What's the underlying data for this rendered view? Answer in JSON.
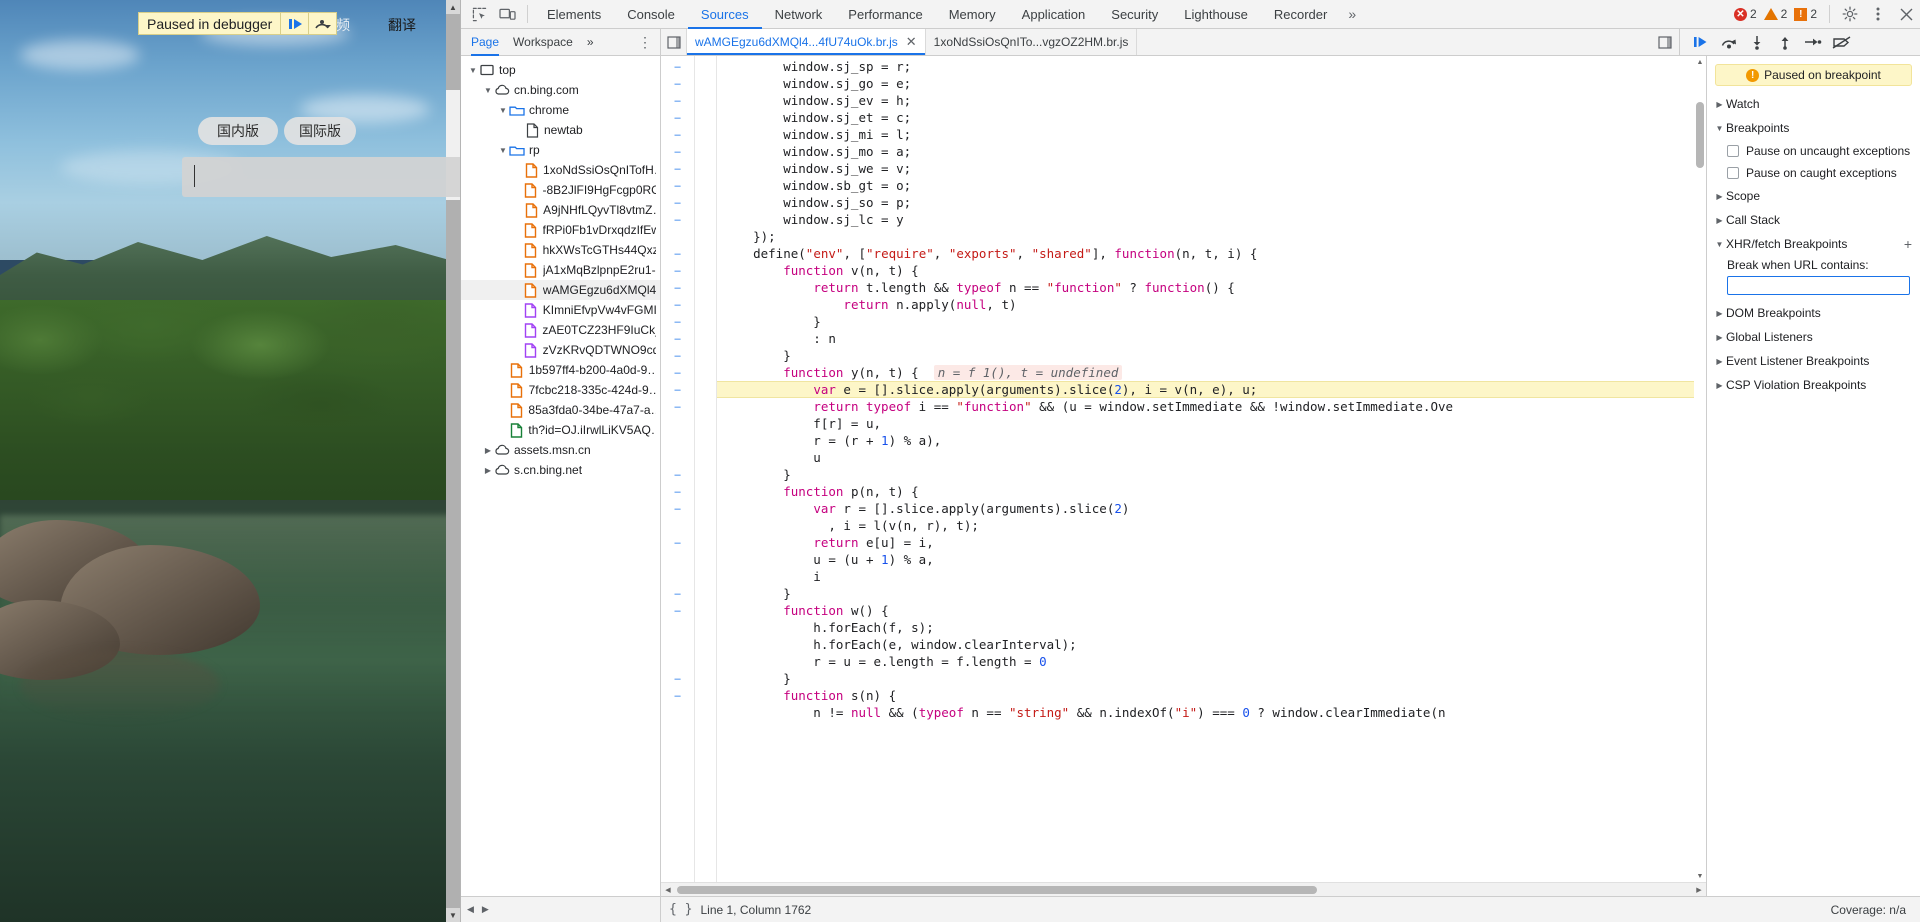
{
  "browser": {
    "paused_banner": {
      "text": "Paused in debugger",
      "resume_icon": "resume-icon",
      "step-over_icon": "step-over-icon"
    },
    "labels": {
      "video": "视频",
      "translate": "翻译"
    },
    "buttons": {
      "domestic": "国内版",
      "international": "国际版"
    },
    "search_placeholder": ""
  },
  "devtools": {
    "tabs": [
      {
        "label": "Elements",
        "active": false
      },
      {
        "label": "Console",
        "active": false
      },
      {
        "label": "Sources",
        "active": true
      },
      {
        "label": "Network",
        "active": false
      },
      {
        "label": "Performance",
        "active": false
      },
      {
        "label": "Memory",
        "active": false
      },
      {
        "label": "Application",
        "active": false
      },
      {
        "label": "Security",
        "active": false
      },
      {
        "label": "Lighthouse",
        "active": false
      },
      {
        "label": "Recorder",
        "active": false
      }
    ],
    "overflow_label": "»",
    "counters": {
      "errors": "2",
      "warnings": "2",
      "issues": "2"
    },
    "navigator_tabs": [
      {
        "label": "Page",
        "active": true
      },
      {
        "label": "Workspace",
        "active": false
      },
      {
        "label": "»",
        "active": false
      }
    ],
    "file_tabs": [
      {
        "label": "wAMGEgzu6dXMQl4...4fU74uOk.br.js",
        "active": true,
        "closeable": true
      },
      {
        "label": "1xoNdSsiOsQnITo...vgzOZ2HM.br.js",
        "active": false,
        "closeable": false
      }
    ],
    "debug_toolbar": [
      {
        "name": "resume-script-execution",
        "label": "▶"
      },
      {
        "name": "step-over-next-call",
        "label": "↷"
      },
      {
        "name": "step-into-next-call",
        "label": "↓"
      },
      {
        "name": "step-out-of-current-function",
        "label": "↑"
      },
      {
        "name": "step",
        "label": "→"
      },
      {
        "name": "deactivate-breakpoints",
        "label": "⊘"
      }
    ],
    "tree": [
      {
        "indent": 0,
        "twisty": "▼",
        "icon": "frame-icon",
        "label": "top"
      },
      {
        "indent": 1,
        "twisty": "▼",
        "icon": "cloud-icon",
        "label": "cn.bing.com"
      },
      {
        "indent": 2,
        "twisty": "▼",
        "icon": "folder-icon",
        "label": "chrome"
      },
      {
        "indent": 3,
        "twisty": "",
        "icon": "document-icon",
        "label": "newtab"
      },
      {
        "indent": 2,
        "twisty": "▼",
        "icon": "folder-icon",
        "label": "rp"
      },
      {
        "indent": 3,
        "twisty": "",
        "icon": "js-file-icon",
        "label": "1xoNdSsiOsQnITofH…"
      },
      {
        "indent": 3,
        "twisty": "",
        "icon": "js-file-icon",
        "label": "-8B2JlFI9HgFcgp0RG…"
      },
      {
        "indent": 3,
        "twisty": "",
        "icon": "js-file-icon",
        "label": "A9jNHfLQyvTl8vtmZ…"
      },
      {
        "indent": 3,
        "twisty": "",
        "icon": "js-file-icon",
        "label": "fRPi0Fb1vDrxqdzIfEw…"
      },
      {
        "indent": 3,
        "twisty": "",
        "icon": "js-file-icon",
        "label": "hkXWsTcGTHs44Qxz…"
      },
      {
        "indent": 3,
        "twisty": "",
        "icon": "js-file-icon",
        "label": "jA1xMqBzlpnpE2ru1-…"
      },
      {
        "indent": 3,
        "twisty": "",
        "icon": "js-file-icon",
        "label": "wAMGEgzu6dXMQl4…",
        "selected": true
      },
      {
        "indent": 3,
        "twisty": "",
        "icon": "css-file-icon",
        "label": "KImniEfvpVw4vFGMI…"
      },
      {
        "indent": 3,
        "twisty": "",
        "icon": "css-file-icon",
        "label": "zAE0TCZ23HF9IuCk_…"
      },
      {
        "indent": 3,
        "twisty": "",
        "icon": "css-file-icon",
        "label": "zVzKRvQDTWNO9cq…"
      },
      {
        "indent": 2,
        "twisty": "",
        "icon": "js-file-icon",
        "label": "1b597ff4-b200-4a0d-9…"
      },
      {
        "indent": 2,
        "twisty": "",
        "icon": "js-file-icon",
        "label": "7fcbc218-335c-424d-9…"
      },
      {
        "indent": 2,
        "twisty": "",
        "icon": "js-file-icon",
        "label": "85a3fda0-34be-47a7-a…"
      },
      {
        "indent": 2,
        "twisty": "",
        "icon": "image-file-icon",
        "label": "th?id=OJ.iIrwlLiKV5AQ…"
      },
      {
        "indent": 1,
        "twisty": "▶",
        "icon": "cloud-icon",
        "label": "assets.msn.cn"
      },
      {
        "indent": 1,
        "twisty": "▶",
        "icon": "cloud-icon",
        "label": "s.cn.bing.net"
      }
    ],
    "code_lines": [
      {
        "text": "        window.sj_sp = r;",
        "fold": "–"
      },
      {
        "text": "        window.sj_go = e;",
        "fold": "–"
      },
      {
        "text": "        window.sj_ev = h;",
        "fold": "–"
      },
      {
        "text": "        window.sj_et = c;",
        "fold": "–"
      },
      {
        "text": "        window.sj_mi = l;",
        "fold": "–"
      },
      {
        "text": "        window.sj_mo = a;",
        "fold": "–"
      },
      {
        "text": "        window.sj_we = v;",
        "fold": "–"
      },
      {
        "text": "        window.sb_gt = o;",
        "fold": "–"
      },
      {
        "text": "        window.sj_so = p;",
        "fold": "–"
      },
      {
        "text": "        window.sj_lc = y",
        "fold": "–"
      },
      {
        "text": "    });",
        "fold": ""
      },
      {
        "text": "    define(\"env\", [\"require\", \"exports\", \"shared\"], function(n, t, i) {",
        "fold": "–"
      },
      {
        "text": "        function v(n, t) {",
        "fold": "–"
      },
      {
        "text": "            return t.length && typeof n == \"function\" ? function() {",
        "fold": "–"
      },
      {
        "text": "                return n.apply(null, t)",
        "fold": "–"
      },
      {
        "text": "            }",
        "fold": "–"
      },
      {
        "text": "            : n",
        "fold": "–"
      },
      {
        "text": "        }",
        "fold": "–"
      },
      {
        "text": "        function y(n, t) {",
        "fold": "–",
        "annotation": "n = f 1(), t = undefined"
      },
      {
        "text": "            var e = [].slice.apply(arguments).slice(2), i = v(n, e), u;",
        "fold": "–",
        "highlight": true
      },
      {
        "text": "            return typeof i == \"function\" && (u = window.setImmediate && !window.setImmediate.Ove",
        "fold": "–"
      },
      {
        "text": "            f[r] = u,",
        "fold": ""
      },
      {
        "text": "            r = (r + 1) % a),",
        "fold": ""
      },
      {
        "text": "            u",
        "fold": ""
      },
      {
        "text": "        }",
        "fold": "–"
      },
      {
        "text": "        function p(n, t) {",
        "fold": "–"
      },
      {
        "text": "            var r = [].slice.apply(arguments).slice(2)",
        "fold": "–"
      },
      {
        "text": "              , i = l(v(n, r), t);",
        "fold": ""
      },
      {
        "text": "            return e[u] = i,",
        "fold": "–"
      },
      {
        "text": "            u = (u + 1) % a,",
        "fold": ""
      },
      {
        "text": "            i",
        "fold": ""
      },
      {
        "text": "        }",
        "fold": "–"
      },
      {
        "text": "        function w() {",
        "fold": "–"
      },
      {
        "text": "            h.forEach(f, s);",
        "fold": ""
      },
      {
        "text": "            h.forEach(e, window.clearInterval);",
        "fold": ""
      },
      {
        "text": "            r = u = e.length = f.length = 0",
        "fold": ""
      },
      {
        "text": "        }",
        "fold": "–"
      },
      {
        "text": "        function s(n) {",
        "fold": "–"
      },
      {
        "text": "            n != null && (typeof n == \"string\" && n.indexOf(\"i\") === 0 ? window.clearImmediate(n",
        "fold": ""
      }
    ],
    "sidebar": {
      "pause_reason": "Paused on breakpoint",
      "sections": [
        {
          "label": "Watch",
          "expanded": false,
          "plus": false
        },
        {
          "label": "Breakpoints",
          "expanded": true,
          "plus": false
        },
        {
          "label": "Scope",
          "expanded": false,
          "plus": false
        },
        {
          "label": "Call Stack",
          "expanded": false,
          "plus": false
        },
        {
          "label": "XHR/fetch Breakpoints",
          "expanded": true,
          "plus": true
        },
        {
          "label": "DOM Breakpoints",
          "expanded": false,
          "plus": false
        },
        {
          "label": "Global Listeners",
          "expanded": false,
          "plus": false
        },
        {
          "label": "Event Listener Breakpoints",
          "expanded": false,
          "plus": false
        },
        {
          "label": "CSP Violation Breakpoints",
          "expanded": false,
          "plus": false
        }
      ],
      "breakpoint_options": [
        {
          "label": "Pause on uncaught exceptions",
          "checked": false
        },
        {
          "label": "Pause on caught exceptions",
          "checked": false
        }
      ],
      "xhr": {
        "label": "Break when URL contains:",
        "value": "",
        "placeholder": ""
      }
    },
    "statusbar": {
      "position": "Line 1, Column 1762",
      "coverage": "Coverage: n/a",
      "format_icon": "pretty-print-icon"
    }
  },
  "colors": {
    "accent": "#1a73e8",
    "error": "#d93025",
    "warning": "#e37400",
    "issue": "#e8710a",
    "highlight": "#fdf6c8"
  }
}
